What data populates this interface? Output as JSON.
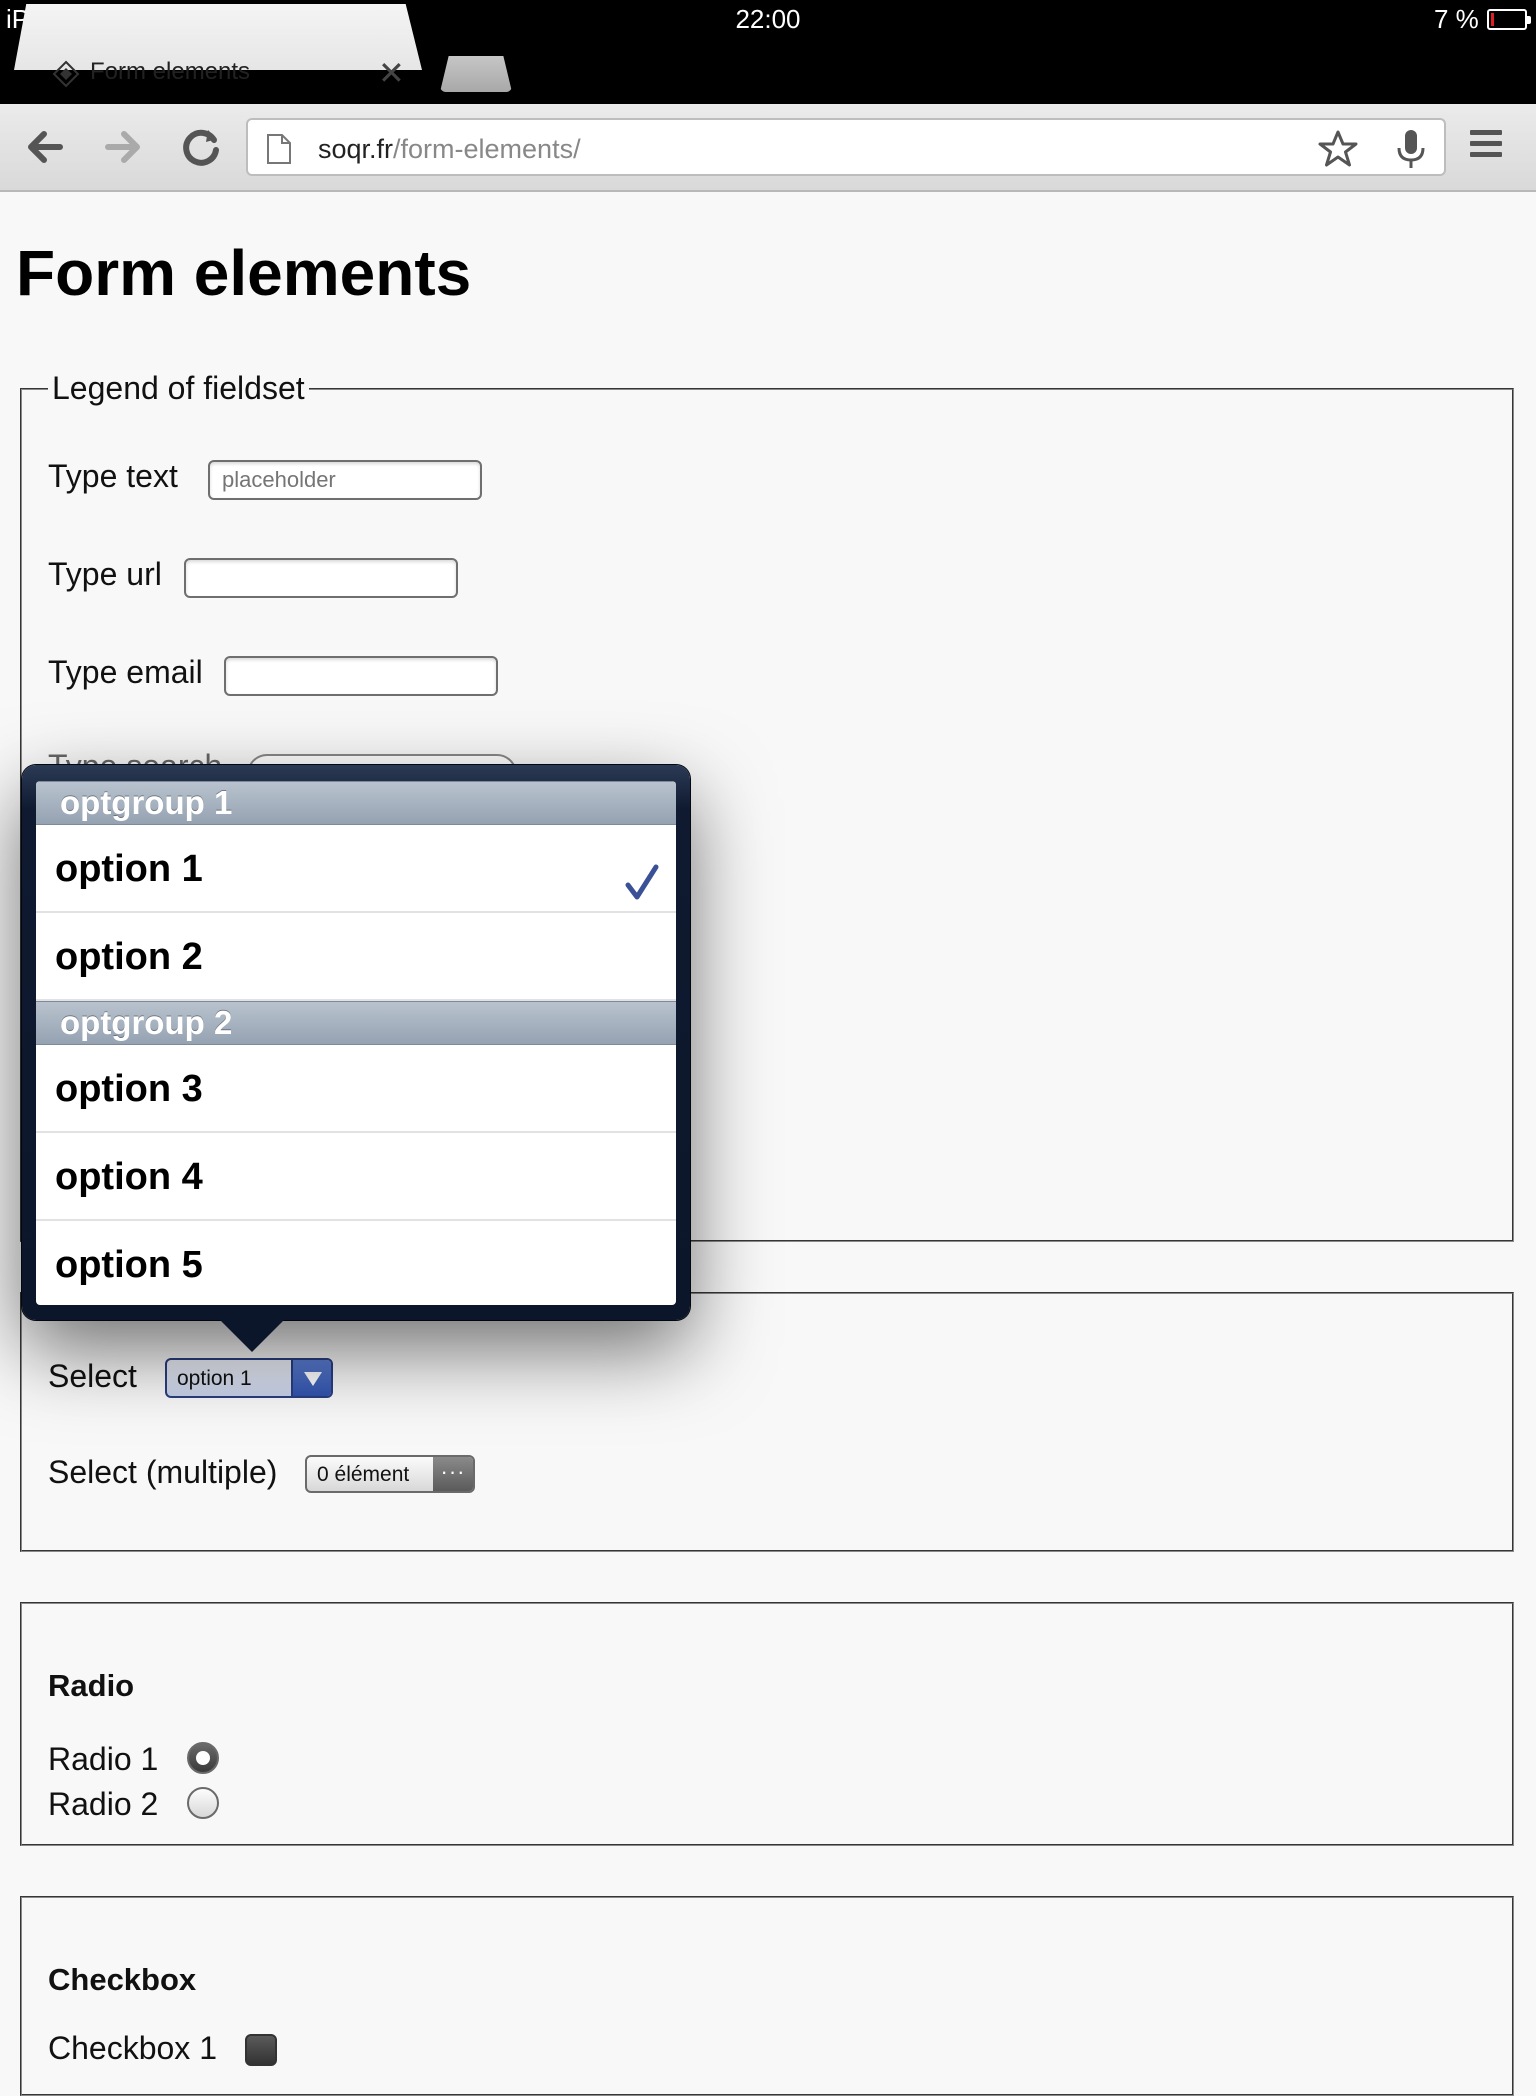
{
  "status_bar": {
    "device": "iPad",
    "time": "22:00",
    "battery_percent": "7 %"
  },
  "browser": {
    "tab_title": "Form elements",
    "url_host": "soqr.fr",
    "url_path": "/form-elements/"
  },
  "page": {
    "title": "Form elements",
    "fieldset1": {
      "legend": "Legend of fieldset",
      "type_text_label": "Type text",
      "type_text_placeholder": "placeholder",
      "type_url_label": "Type url",
      "type_email_label": "Type email",
      "type_search_label": "Type search"
    },
    "fieldset2": {
      "select_label": "Select",
      "select_value": "option 1",
      "select_multiple_label": "Select (multiple)",
      "select_multiple_value": "0 élément"
    },
    "radio_section": {
      "heading": "Radio",
      "radio1_label": "Radio 1",
      "radio2_label": "Radio 2",
      "selected": "Radio 1"
    },
    "checkbox_section": {
      "heading": "Checkbox",
      "checkbox1_label": "Checkbox 1"
    }
  },
  "select_popover": {
    "groups": [
      {
        "label": "optgroup 1",
        "options": [
          "option 1",
          "option 2"
        ]
      },
      {
        "label": "optgroup 2",
        "options": [
          "option 3",
          "option 4",
          "option 5"
        ]
      }
    ],
    "selected": "option 1"
  }
}
